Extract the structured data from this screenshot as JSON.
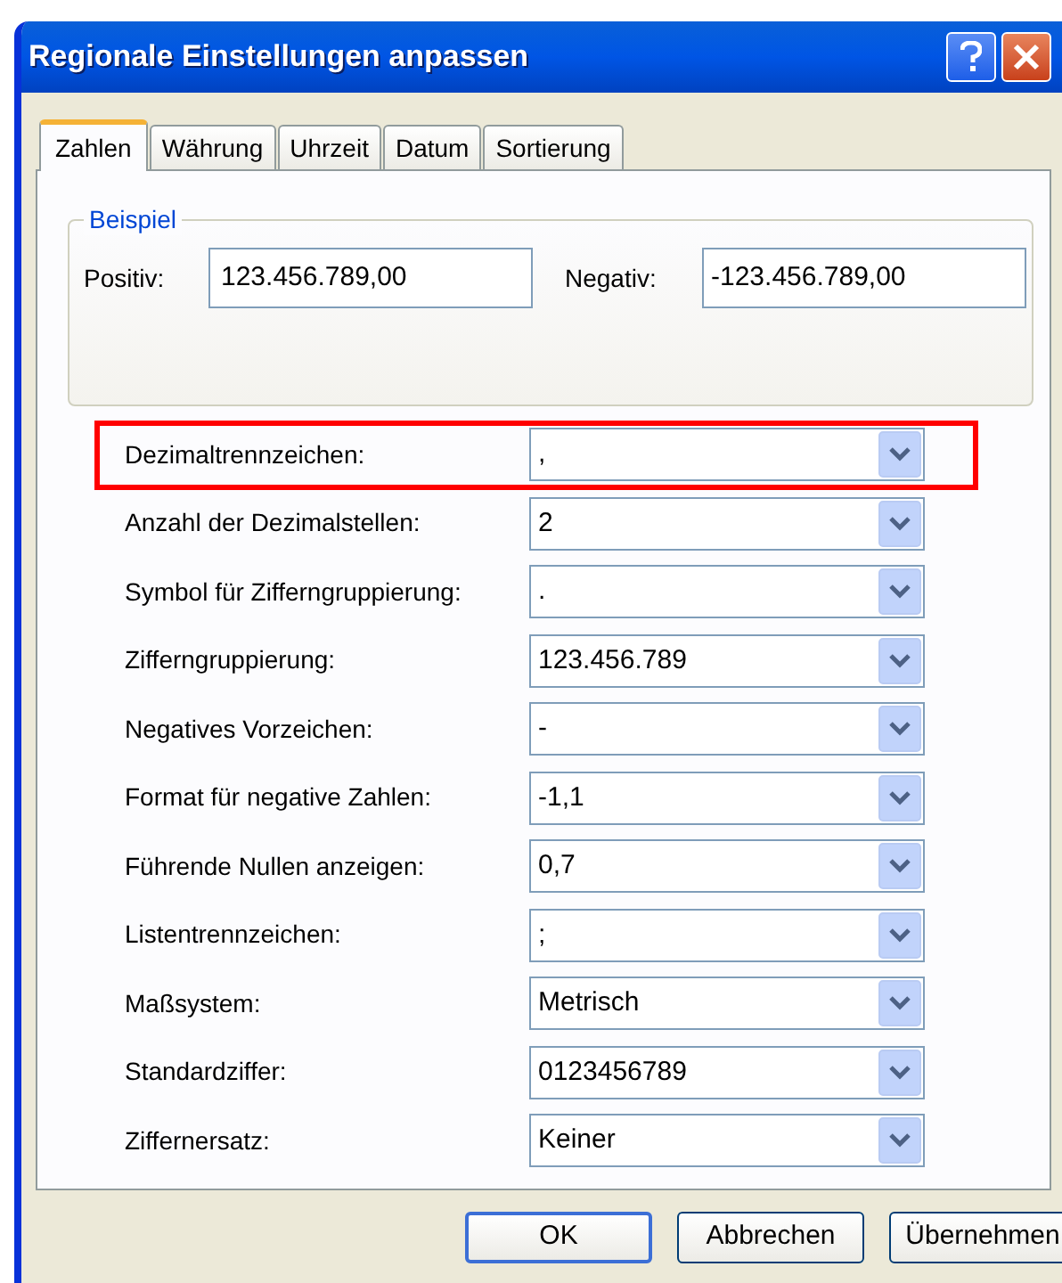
{
  "window": {
    "title": "Regionale Einstellungen anpassen"
  },
  "tabs": [
    {
      "label": "Zahlen",
      "selected": true
    },
    {
      "label": "Währung",
      "selected": false
    },
    {
      "label": "Uhrzeit",
      "selected": false
    },
    {
      "label": "Datum",
      "selected": false
    },
    {
      "label": "Sortierung",
      "selected": false
    }
  ],
  "example": {
    "title": "Beispiel",
    "positive_label": "Positiv:",
    "positive_value": "123.456.789,00",
    "negative_label": "Negativ:",
    "negative_value": "-123.456.789,00"
  },
  "settings": [
    {
      "label": "Dezimaltrennzeichen:",
      "value": ",",
      "highlighted": true
    },
    {
      "label": "Anzahl der Dezimalstellen:",
      "value": "2",
      "highlighted": false
    },
    {
      "label": "Symbol für Zifferngruppierung:",
      "value": ".",
      "highlighted": false
    },
    {
      "label": "Zifferngruppierung:",
      "value": "123.456.789",
      "highlighted": false
    },
    {
      "label": "Negatives Vorzeichen:",
      "value": "-",
      "highlighted": false
    },
    {
      "label": "Format für negative Zahlen:",
      "value": "-1,1",
      "highlighted": false
    },
    {
      "label": "Führende Nullen anzeigen:",
      "value": "0,7",
      "highlighted": false
    },
    {
      "label": "Listentrennzeichen:",
      "value": ";",
      "highlighted": false
    },
    {
      "label": "Maßsystem:",
      "value": "Metrisch",
      "highlighted": false
    },
    {
      "label": "Standardziffer:",
      "value": "0123456789",
      "highlighted": false
    },
    {
      "label": "Ziffernersatz:",
      "value": "Keiner",
      "highlighted": false
    }
  ],
  "buttons": [
    {
      "label": "OK",
      "default": true
    },
    {
      "label": "Abbrechen",
      "default": false
    },
    {
      "label": "Übernehmen",
      "default": false
    }
  ]
}
